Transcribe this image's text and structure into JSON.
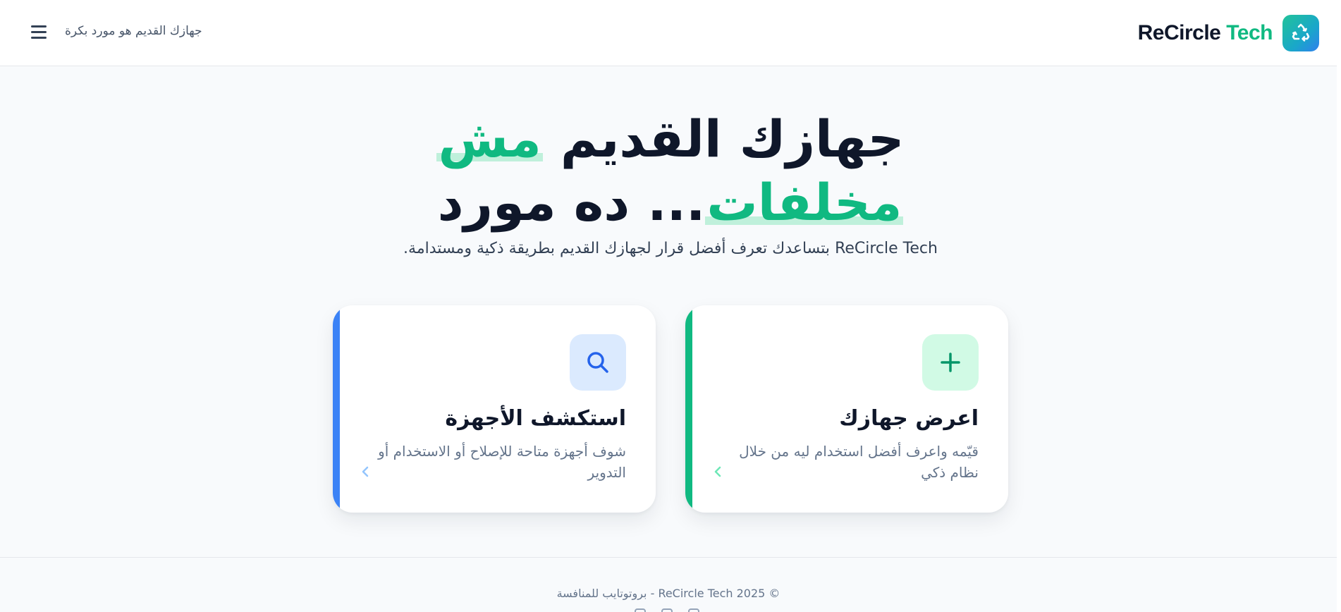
{
  "header": {
    "brand_name_part1": "ReCircle",
    "brand_name_part2": " Tech",
    "tagline": "جهازك القديم هو مورد بكرة"
  },
  "hero": {
    "title_line1_text": "جهازك القديم ",
    "title_line1_highlight": "مش",
    "title_line2_highlight": "مخلفات",
    "title_line2_text": "... ده مورد",
    "subtitle": "ReCircle Tech بتساعدك تعرف أفضل قرار لجهازك القديم بطريقة ذكية ومستدامة."
  },
  "cards": [
    {
      "title": "اعرض جهازك",
      "description": "قيّمه واعرف أفضل استخدام ليه من خلال نظام ذكي",
      "icon": "plus-icon",
      "accent": "#10b981"
    },
    {
      "title": "استكشف الأجهزة",
      "description": "شوف أجهزة متاحة للإصلاح أو الاستخدام أو التدوير",
      "icon": "search-icon",
      "accent": "#3b82f6"
    }
  ],
  "footer": {
    "copyright": "© 2025 ReCircle Tech - بروتوتايب للمنافسة"
  },
  "colors": {
    "brand_green": "#10b981",
    "brand_blue": "#3b82f6",
    "text_dark": "#0f172a",
    "text_muted": "#64748b",
    "background": "#f8fafc"
  }
}
